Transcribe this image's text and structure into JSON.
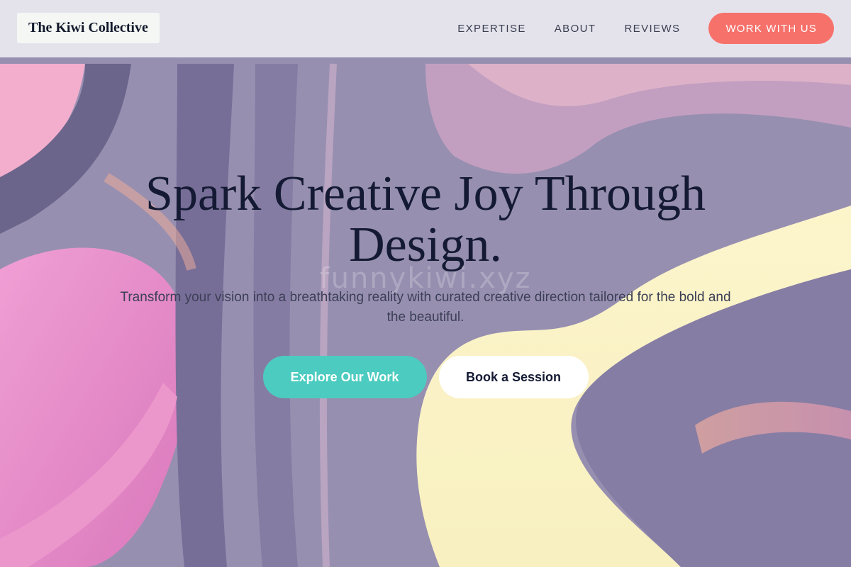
{
  "header": {
    "brand": "The Kiwi Collective",
    "nav": [
      {
        "label": "EXPERTISE"
      },
      {
        "label": "ABOUT"
      },
      {
        "label": "REVIEWS"
      }
    ],
    "cta_label": "WORK WITH US"
  },
  "hero": {
    "title": "Spark Creative Joy Through Design.",
    "subtitle": "Transform your vision into a breathtaking reality with curated creative direction tailored for the bold and the beautiful.",
    "primary_button": "Explore Our Work",
    "secondary_button": "Book a Session",
    "watermark": "funnykiwi.xyz"
  },
  "colors": {
    "accent_coral": "#f7716b",
    "accent_teal": "#4ccbc0",
    "heading_navy": "#141a33"
  }
}
